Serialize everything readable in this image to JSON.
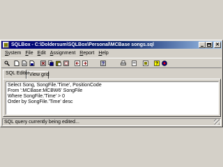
{
  "window": {
    "title": "SQLBox - C:\\Doldersum\\SQLBox\\Personal\\MCBase songs.sql"
  },
  "menu": [
    {
      "label": "System",
      "key": "S",
      "rest": "ystem"
    },
    {
      "label": "File",
      "key": "F",
      "rest": "ile"
    },
    {
      "label": "Edit",
      "key": "E",
      "rest": "dit"
    },
    {
      "label": "Assignment",
      "key": "A",
      "rest": "ssignment"
    },
    {
      "label": "Report",
      "key": "R",
      "rest": "eport"
    },
    {
      "label": "Help",
      "key": "H",
      "rest": "elp"
    }
  ],
  "toolbar_icons": [
    "find-icon",
    "new-document-icon",
    "open-document-icon",
    "save-document-icon",
    "cut-icon",
    "copy-icon",
    "paste-icon",
    "move-left-icon",
    "move-right-icon",
    "help-search-icon",
    "print-icon",
    "print-preview-icon",
    "export-icon",
    "help-icon",
    "about-icon"
  ],
  "tabs": {
    "sql_editor": "SQL Editor",
    "view_grid": "View grid"
  },
  "editor": {
    "lines": [
      "Select Song, SongFile.'Time', PositionCode",
      "From ':MCBase:MCBW6' SongFile",
      "Where SongFile.'Time' > 0",
      "Order by SongFile.'Time' desc"
    ]
  },
  "status": {
    "text": "SQL query currently being edited..."
  },
  "colors": {
    "title_start": "#00007b",
    "title_end": "#a6caf0",
    "face": "#d4d0c8"
  }
}
